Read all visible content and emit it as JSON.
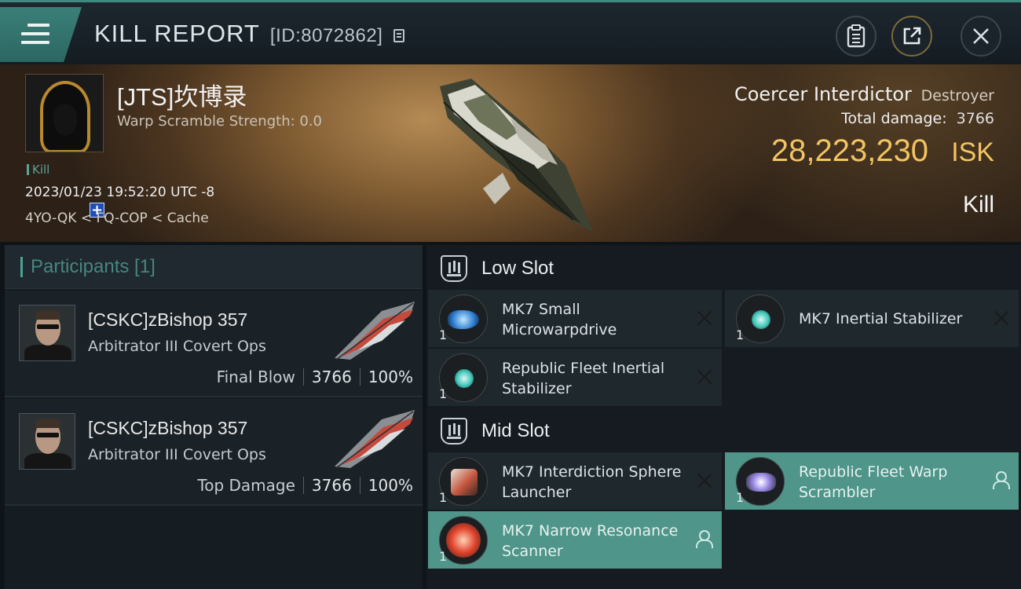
{
  "header": {
    "title": "KILL REPORT",
    "kill_id": "[ID:8072862]"
  },
  "victim": {
    "name": "[JTS]坎博录",
    "warp_scramble": "Warp Scramble Strength: 0.0",
    "kill_tag": "Kill",
    "datetime": "2023/01/23 19:52:20 UTC -8",
    "location": "4YO-QK < FQ-COP < Cache",
    "ship_name": "Coercer Interdictor",
    "ship_class": "Destroyer",
    "total_damage_label": "Total damage:",
    "total_damage": "3766",
    "isk_value": "28,223,230",
    "isk_unit": "ISK",
    "result": "Kill"
  },
  "participants": {
    "header": "Participants [1]",
    "list": [
      {
        "name": "[CSKC]zBishop 357",
        "ship": "Arbitrator III Covert Ops",
        "role": "Final Blow",
        "damage": "3766",
        "percent": "100%"
      },
      {
        "name": "[CSKC]zBishop 357",
        "ship": "Arbitrator III Covert Ops",
        "role": "Top Damage",
        "damage": "3766",
        "percent": "100%"
      }
    ]
  },
  "fitting": {
    "low_slot": {
      "title": "Low Slot",
      "modules": [
        {
          "name": "MK7 Small Microwarpdrive",
          "qty": "1",
          "status": "destroyed"
        },
        {
          "name": "MK7 Inertial Stabilizer",
          "qty": "1",
          "status": "destroyed"
        },
        {
          "name": "Republic Fleet Inertial Stabilizer",
          "qty": "1",
          "status": "destroyed"
        }
      ]
    },
    "mid_slot": {
      "title": "Mid Slot",
      "modules": [
        {
          "name": "MK7 Interdiction Sphere Launcher",
          "qty": "1",
          "status": "destroyed"
        },
        {
          "name": "Republic Fleet Warp Scrambler",
          "qty": "1",
          "status": "dropped"
        },
        {
          "name": "MK7 Narrow Resonance Scanner",
          "qty": "1",
          "status": "dropped"
        }
      ]
    }
  },
  "colors": {
    "accent_teal": "#4f9589",
    "isk_gold": "#f2c462",
    "menu_teal": "#3b7f79"
  },
  "icons": [
    "menu-icon",
    "copy-icon",
    "report-icon",
    "share-icon",
    "close-icon",
    "slot-icon",
    "destroyed-icon",
    "dropped-icon"
  ]
}
